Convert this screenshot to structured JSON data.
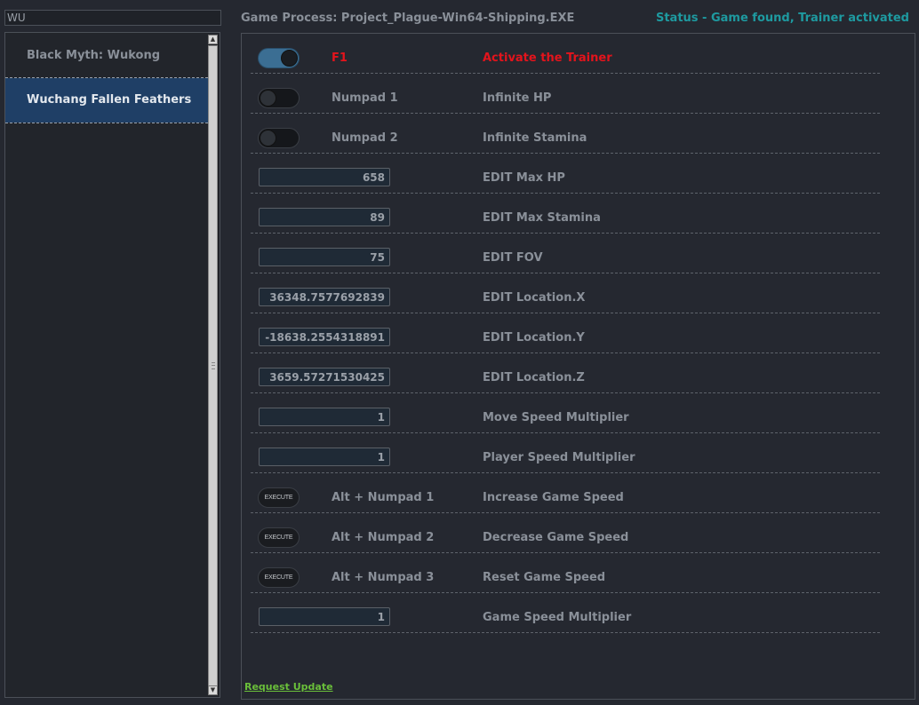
{
  "search": {
    "value": "WU"
  },
  "games": [
    {
      "label": "Black Myth: Wukong"
    },
    {
      "label": "Wuchang Fallen Feathers"
    }
  ],
  "header": {
    "process": "Game Process: Project_Plague-Win64-Shipping.EXE",
    "status": "Status - Game found, Trainer activated"
  },
  "rows": [
    {
      "hotkey": "F1",
      "label": "Activate the Trainer"
    },
    {
      "hotkey": "Numpad 1",
      "label": "Infinite HP"
    },
    {
      "hotkey": "Numpad 2",
      "label": "Infinite Stamina"
    },
    {
      "value": "658",
      "label": "EDIT Max HP"
    },
    {
      "value": "89",
      "label": "EDIT Max Stamina"
    },
    {
      "value": "75",
      "label": "EDIT FOV"
    },
    {
      "value": "36348.7577692839",
      "label": "EDIT Location.X"
    },
    {
      "value": "-18638.2554318891",
      "label": "EDIT Location.Y"
    },
    {
      "value": "3659.57271530425",
      "label": "EDIT Location.Z"
    },
    {
      "value": "1",
      "label": "Move Speed Multiplier"
    },
    {
      "value": "1",
      "label": "Player Speed Multiplier"
    },
    {
      "button": "EXECUTE",
      "hotkey": "Alt + Numpad 1",
      "label": "Increase Game Speed"
    },
    {
      "button": "EXECUTE",
      "hotkey": "Alt + Numpad 2",
      "label": "Decrease Game Speed"
    },
    {
      "button": "EXECUTE",
      "hotkey": "Alt + Numpad 3",
      "label": "Reset Game Speed"
    },
    {
      "value": "1",
      "label": "Game Speed Multiplier"
    }
  ],
  "footer": {
    "request_update": "Request Update"
  },
  "colors": {
    "accent": "#3b6e93",
    "status": "#1e9aa0",
    "alert": "#e3141c",
    "link": "#6abf3a",
    "selected": "#1f3f66"
  }
}
